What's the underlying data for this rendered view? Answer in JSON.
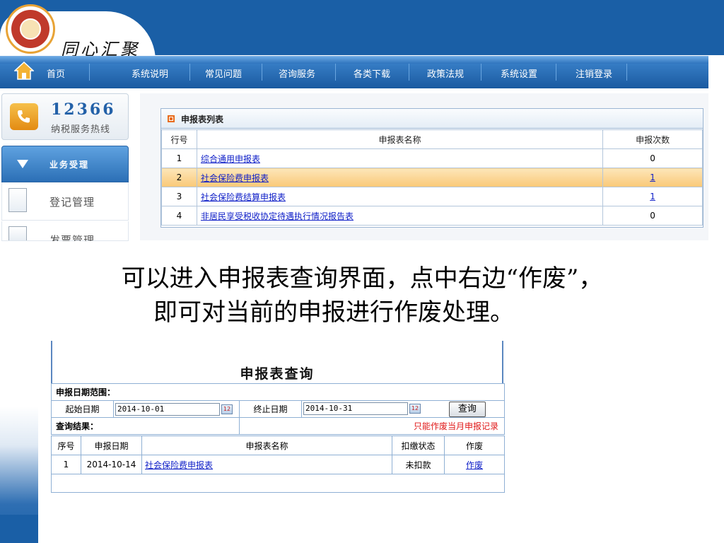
{
  "logo": {
    "text": "同心汇聚"
  },
  "nav": {
    "items": [
      "首页",
      "系统说明",
      "常见问题",
      "咨询服务",
      "各类下载",
      "政策法规",
      "系统设置",
      "注销登录"
    ]
  },
  "hotline": {
    "number": "12366",
    "label": "纳税服务热线"
  },
  "sidebar": {
    "header": "业务受理",
    "items": [
      {
        "label": "登记管理"
      },
      {
        "label": "发票管理"
      }
    ]
  },
  "report_list": {
    "title": "申报表列表",
    "columns": [
      "行号",
      "申报表名称",
      "申报次数"
    ],
    "rows": [
      {
        "no": "1",
        "name": "综合通用申报表",
        "count": "0",
        "count_link": false
      },
      {
        "no": "2",
        "name": "社会保险费申报表",
        "count": "1",
        "count_link": true
      },
      {
        "no": "3",
        "name": "社会保险费结算申报表",
        "count": "1",
        "count_link": true
      },
      {
        "no": "4",
        "name": "非居民享受税收协定待遇执行情况报告表",
        "count": "0",
        "count_link": false
      }
    ]
  },
  "caption": {
    "line1": "可以进入申报表查询界面，点中右边“作废”，",
    "line2": "即可对当前的申报进行作废处理。"
  },
  "query": {
    "title": "申报表查询",
    "date_range_label": "申报日期范围：",
    "start_label": "起始日期",
    "start_value": "2014-10-01",
    "end_label": "终止日期",
    "end_value": "2014-10-31",
    "calendar_icon_text": "12",
    "query_button": "查询",
    "result_label": "查询结果：",
    "notice": "只能作废当月申报记录",
    "columns": [
      "序号",
      "申报日期",
      "申报表名称",
      "扣缴状态",
      "作废"
    ],
    "rows": [
      {
        "no": "1",
        "date": "2014-10-14",
        "name": "社会保险费申报表",
        "status": "未扣款",
        "action": "作废"
      }
    ]
  },
  "colors": {
    "brand_blue": "#1a5fa6",
    "link": "#1020c8",
    "highlight": "#f9c877",
    "notice_red": "#e01818"
  }
}
